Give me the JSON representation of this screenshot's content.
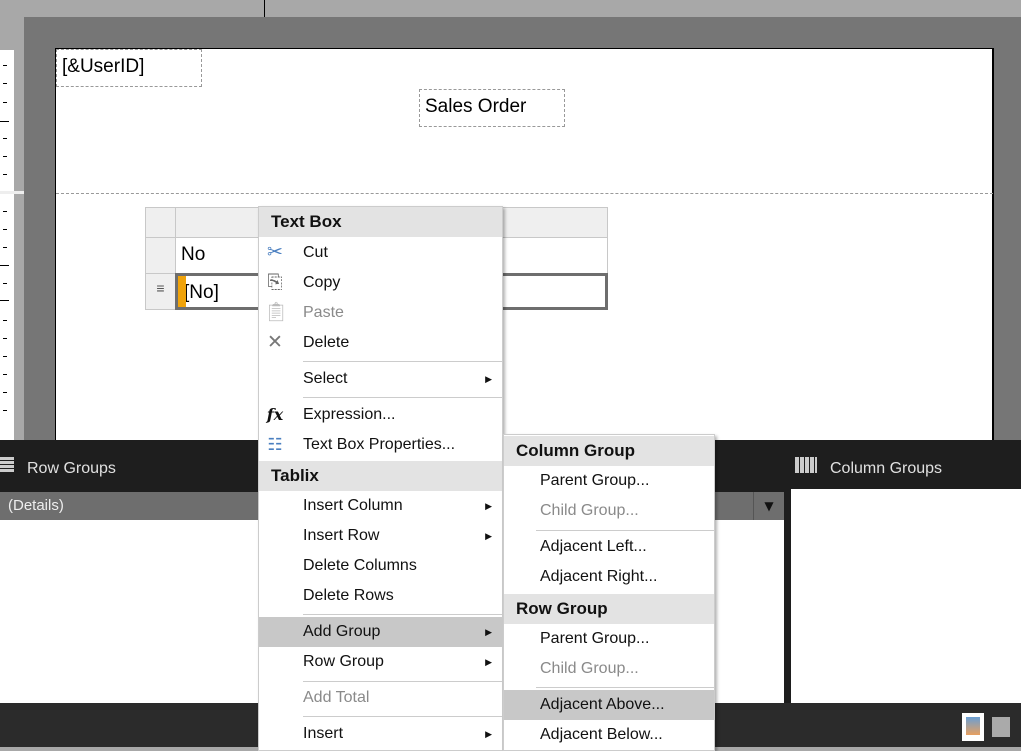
{
  "report": {
    "userid_textbox": "[&UserID]",
    "title_textbox": "Sales Order",
    "tablix": {
      "header_cell": "No",
      "detail_cell": "[No]"
    }
  },
  "panels": {
    "row_groups_title": "Row Groups",
    "column_groups_title": "Column Groups",
    "details_group": "(Details)"
  },
  "context_menu": {
    "textbox_header": "Text Box",
    "cut": "Cut",
    "copy": "Copy",
    "paste": "Paste",
    "delete": "Delete",
    "select": "Select",
    "expression": "Expression...",
    "textbox_properties": "Text Box Properties...",
    "tablix_header": "Tablix",
    "insert_column": "Insert Column",
    "insert_row": "Insert Row",
    "delete_columns": "Delete Columns",
    "delete_rows": "Delete Rows",
    "add_group": "Add Group",
    "row_group": "Row Group",
    "add_total": "Add Total",
    "insert": "Insert"
  },
  "submenu": {
    "column_group_header": "Column Group",
    "col_parent": "Parent Group...",
    "col_child": "Child Group...",
    "adjacent_left": "Adjacent Left...",
    "adjacent_right": "Adjacent Right...",
    "row_group_header": "Row Group",
    "row_parent": "Parent Group...",
    "row_child": "Child Group...",
    "adjacent_above": "Adjacent Above...",
    "adjacent_below": "Adjacent Below..."
  },
  "colors": {
    "accent": "#f0a30a",
    "highlight": "#c8c8c8",
    "panel_bg": "#1e1e1e"
  }
}
